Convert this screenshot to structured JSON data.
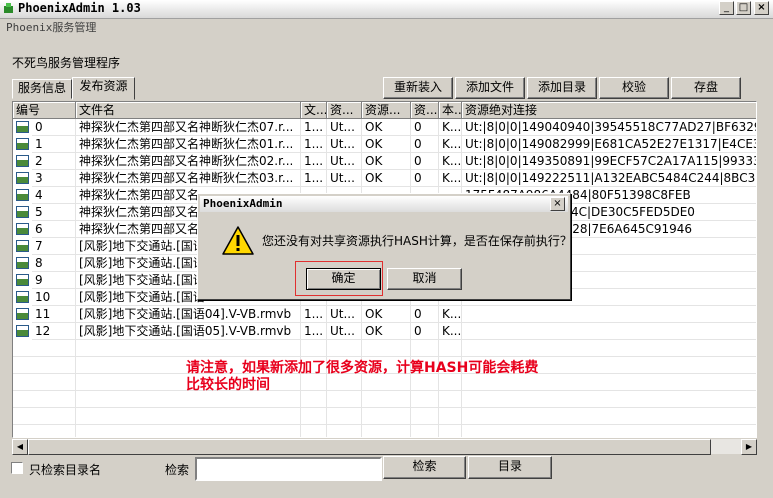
{
  "window": {
    "title": "PhoenixAdmin 1.03",
    "subtitle": "Phoenix服务管理",
    "min_glyph": "_",
    "max_glyph": "□",
    "close_glyph": "×"
  },
  "heading": "不死鸟服务管理程序",
  "tabs": [
    {
      "label": "服务信息",
      "active": false
    },
    {
      "label": "发布资源",
      "active": true
    }
  ],
  "toolbar": {
    "reload": "重新装入",
    "add_file": "添加文件",
    "add_dir": "添加目录",
    "verify": "校验",
    "save": "存盘"
  },
  "columns": [
    "编号",
    "文件名",
    "文...",
    "资...",
    "资源...",
    "资...",
    "本...",
    "资源绝对连接"
  ],
  "rows": [
    [
      "0",
      "神探狄仁杰第四部又名神断狄仁杰07.r...",
      "1...",
      "Ut...",
      "OK",
      "0",
      "K...",
      "Ut:|8|0|0|149040940|39545518C77AD27|BF6329B348E41"
    ],
    [
      "1",
      "神探狄仁杰第四部又名神断狄仁杰01.r...",
      "1...",
      "Ut...",
      "OK",
      "0",
      "K...",
      "Ut:|8|0|0|149082999|E681CA52E27E1317|E4CE38878E5C5"
    ],
    [
      "2",
      "神探狄仁杰第四部又名神断狄仁杰02.r...",
      "1...",
      "Ut...",
      "OK",
      "0",
      "K...",
      "Ut:|8|0|0|149350891|99ECF57C2A17A115|99333508F0EF9"
    ],
    [
      "3",
      "神探狄仁杰第四部又名神断狄仁杰03.r...",
      "1...",
      "Ut...",
      "OK",
      "0",
      "K...",
      "Ut:|8|0|0|149222511|A132EABC5484C244|8BC37229FACE2"
    ],
    [
      "4",
      "神探狄仁杰第四部又名",
      "",
      "",
      "",
      "",
      "",
      "175F487A986A4484|80F51398C8FEB"
    ],
    [
      "5",
      "神探狄仁杰第四部又名",
      "",
      "",
      "",
      "",
      "",
      "A714F811FE68334C|DE30C5FED5DE0"
    ],
    [
      "6",
      "神探狄仁杰第四部又名",
      "",
      "",
      "",
      "",
      "",
      "88901C1FEEAF6A28|7E6A645C91946"
    ],
    [
      "7",
      "[风影]地下交通站.[国语",
      "",
      "",
      "",
      "",
      "",
      ""
    ],
    [
      "8",
      "[风影]地下交通站.[国语",
      "",
      "",
      "",
      "",
      "",
      ""
    ],
    [
      "9",
      "[风影]地下交通站.[国语",
      "",
      "",
      "",
      "",
      "",
      ""
    ],
    [
      "10",
      "[风影]地下交通站.[国语",
      "",
      "",
      "",
      "",
      "",
      ""
    ],
    [
      "11",
      "[风影]地下交通站.[国语04].V-VB.rmvb",
      "1...",
      "Ut...",
      "OK",
      "0",
      "K...",
      ""
    ],
    [
      "12",
      "[风影]地下交通站.[国语05].V-VB.rmvb",
      "1...",
      "Ut...",
      "OK",
      "0",
      "K...",
      ""
    ]
  ],
  "bottom": {
    "only_dir_label": "只检索目录名",
    "search_label": "检索",
    "search_value": "",
    "search_button": "检索",
    "dir_button": "目录"
  },
  "dialog": {
    "title": "PhoenixAdmin",
    "message": "您还没有对共享资源执行HASH计算，是否在保存前执行？",
    "ok": "确定",
    "cancel": "取消",
    "icon": "warning-icon"
  },
  "annotation": "请注意，如果新添加了很多资源，计算HASH可能会耗费比较长的时间",
  "colors": {
    "annotation": "#e8001c",
    "highlight": "#e03030"
  }
}
